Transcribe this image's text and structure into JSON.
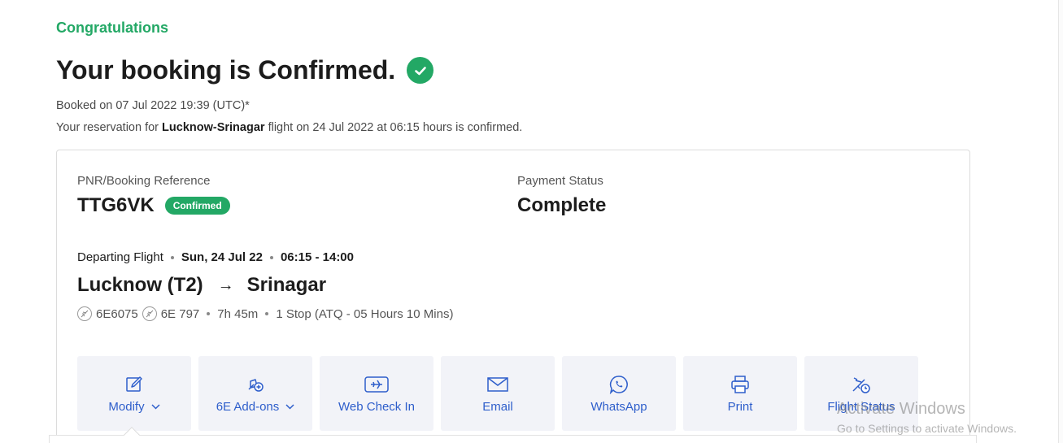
{
  "header": {
    "congrats": "Congratulations",
    "headline": "Your booking is Confirmed.",
    "booked_on": "Booked on 07 Jul 2022 19:39 (UTC)*",
    "reservation_prefix": "Your reservation for ",
    "reservation_route": "Lucknow-Srinagar",
    "reservation_suffix": " flight on 24 Jul 2022 at 06:15 hours is confirmed."
  },
  "booking": {
    "pnr_label": "PNR/Booking Reference",
    "pnr": "TTG6VK",
    "status_badge": "Confirmed",
    "payment_label": "Payment Status",
    "payment_status": "Complete"
  },
  "flight": {
    "departing_label": "Departing Flight",
    "date": "Sun, 24 Jul 22",
    "time": "06:15 - 14:00",
    "origin": "Lucknow (T2)",
    "arrow": "→",
    "destination": "Srinagar",
    "flight_no_1": "6E6075",
    "flight_no_2": "6E 797",
    "duration": "7h 45m",
    "stops": "1 Stop (ATQ - 05 Hours 10 Mins)"
  },
  "actions": [
    {
      "label": "Modify",
      "icon": "edit-icon",
      "dropdown": true
    },
    {
      "label": "6E Add-ons",
      "icon": "addons-icon",
      "dropdown": true
    },
    {
      "label": "Web Check In",
      "icon": "boarding-pass-icon",
      "dropdown": false
    },
    {
      "label": "Email",
      "icon": "envelope-icon",
      "dropdown": false
    },
    {
      "label": "WhatsApp",
      "icon": "whatsapp-icon",
      "dropdown": false
    },
    {
      "label": "Print",
      "icon": "printer-icon",
      "dropdown": false
    },
    {
      "label": "Flight Status",
      "icon": "flight-status-icon",
      "dropdown": false
    }
  ],
  "watermark": {
    "line1": "Activate Windows",
    "line2": "Go to Settings to activate Windows."
  },
  "colors": {
    "accent_green": "#23a865",
    "link_blue": "#2e5ecb",
    "action_bg": "#f2f3f8"
  }
}
